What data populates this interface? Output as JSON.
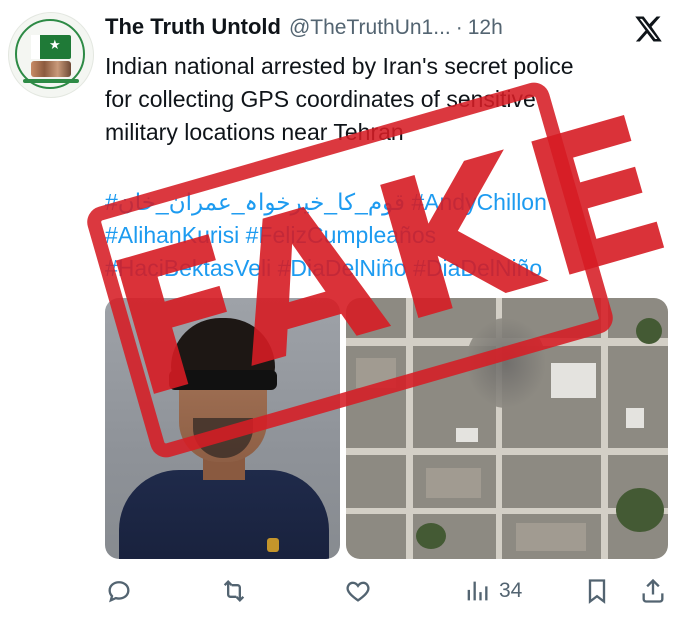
{
  "account": {
    "name": "The Truth Untold",
    "handle": "@TheTruthUn1...",
    "separator": "·",
    "time": "12h"
  },
  "tweet": {
    "text_lines": [
      "Indian national arrested by Iran's secret police",
      "for collecting GPS coordinates of sensitive",
      "military locations near Tehran"
    ],
    "hashtags_line1": "#قوم_کا_خیرخواہ_عمران_خان #AndyChillon",
    "hashtags_line2": "#AlihanKurisi #FelizCumpleaños",
    "hashtags_line3": "#HaciBektasVeli #DiaDelNiño #DiaDelNiño"
  },
  "overlay": {
    "stamp_text": "FAKE",
    "stamp_color": "#d61c24"
  },
  "media": {
    "left_photo": "blindfolded-man-photo",
    "right_photo": "satellite-city-photo"
  },
  "actions": {
    "views_count": "34"
  },
  "icons": {
    "x_logo": "x-logo-icon",
    "reply": "reply-icon",
    "retweet": "retweet-icon",
    "like": "heart-icon",
    "views": "bar-chart-icon",
    "bookmark": "bookmark-icon",
    "share": "share-icon"
  },
  "colors": {
    "link": "#1d9bf0",
    "secondary_text": "#536471",
    "primary_text": "#0f1419"
  }
}
